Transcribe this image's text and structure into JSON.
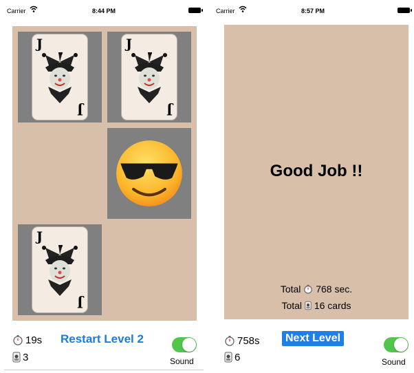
{
  "left_screen": {
    "status": {
      "carrier": "Carrier",
      "time": "8:44 PM"
    },
    "cards": [
      {
        "rank": "J",
        "icon": "jester"
      },
      {
        "rank": "J",
        "icon": "jester"
      },
      {
        "icon": "smiling-face-with-sunglasses"
      },
      {
        "rank": "J",
        "icon": "jester"
      }
    ],
    "stats": {
      "time": "19s",
      "cards": "3"
    },
    "restart_label": "Restart Level 2",
    "sound_label": "Sound",
    "sound_on": true
  },
  "right_screen": {
    "status": {
      "carrier": "Carrier",
      "time": "8:57 PM"
    },
    "message": "Good Job !!",
    "total_time": {
      "prefix": "Total",
      "value": "768 sec."
    },
    "total_cards": {
      "prefix": "Total",
      "value": "16 cards"
    },
    "stats": {
      "time": "758s",
      "cards": "6"
    },
    "next_level_label": "Next Level",
    "sound_label": "Sound",
    "sound_on": true
  },
  "colors": {
    "board": "#d8bfa9",
    "tile": "#808080",
    "link": "#1a7be0",
    "toggle_on": "#52c64c"
  }
}
